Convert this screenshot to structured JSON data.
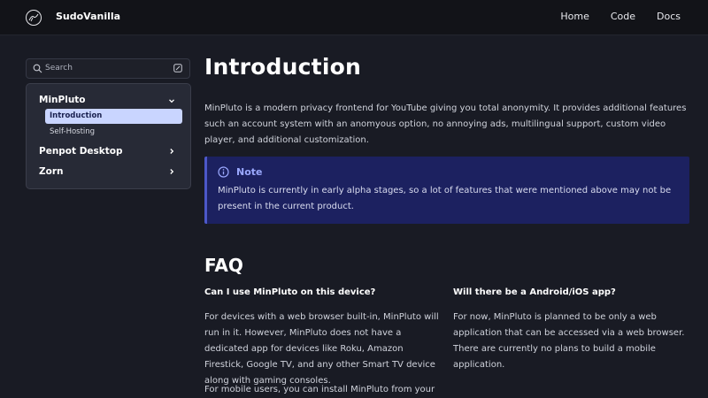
{
  "header": {
    "brand": "SudoVanilla",
    "nav": [
      "Home",
      "Code",
      "Docs"
    ]
  },
  "sidebar": {
    "search_placeholder": "Search",
    "groups": [
      {
        "label": "MinPluto",
        "expanded": true,
        "items": [
          "Introduction",
          "Self-Hosting"
        ],
        "active": "Introduction"
      },
      {
        "label": "Penpot Desktop",
        "expanded": false
      },
      {
        "label": "Zorn",
        "expanded": false
      }
    ]
  },
  "main": {
    "title": "Introduction",
    "intro": "MinPluto is a modern privacy frontend for YouTube giving you total anonymity. It provides additional features such an account system with an anomyous option, no annoying ads, multilingual support, custom video player, and additional customization.",
    "note": {
      "title": "Note",
      "text": "MinPluto is currently in early alpha stages, so a lot of features that were mentioned above may not be present in the current product."
    },
    "faq_title": "FAQ",
    "faq": [
      {
        "question": "Can I use MinPluto on this device?",
        "answer": "For devices with a web browser built-in, MinPluto will run in it. However, MinPluto does not have a dedicated app for devices like Roku, Amazon Firestick, Google TV, and any other Smart TV device along with gaming consoles.",
        "answer_2": "For mobile users, you can install MinPluto from your"
      },
      {
        "question": "Will there be a Android/iOS app?",
        "answer": "For now, MinPluto is planned to be only a web application that can be accessed via a web browser. There are currently no plans to build a mobile application."
      }
    ]
  },
  "colors": {
    "background": "#191b24",
    "header": "#121318",
    "active_item_bg": "#c9d5ff",
    "note_bg": "#1c2160",
    "note_accent": "#4c58c8"
  }
}
